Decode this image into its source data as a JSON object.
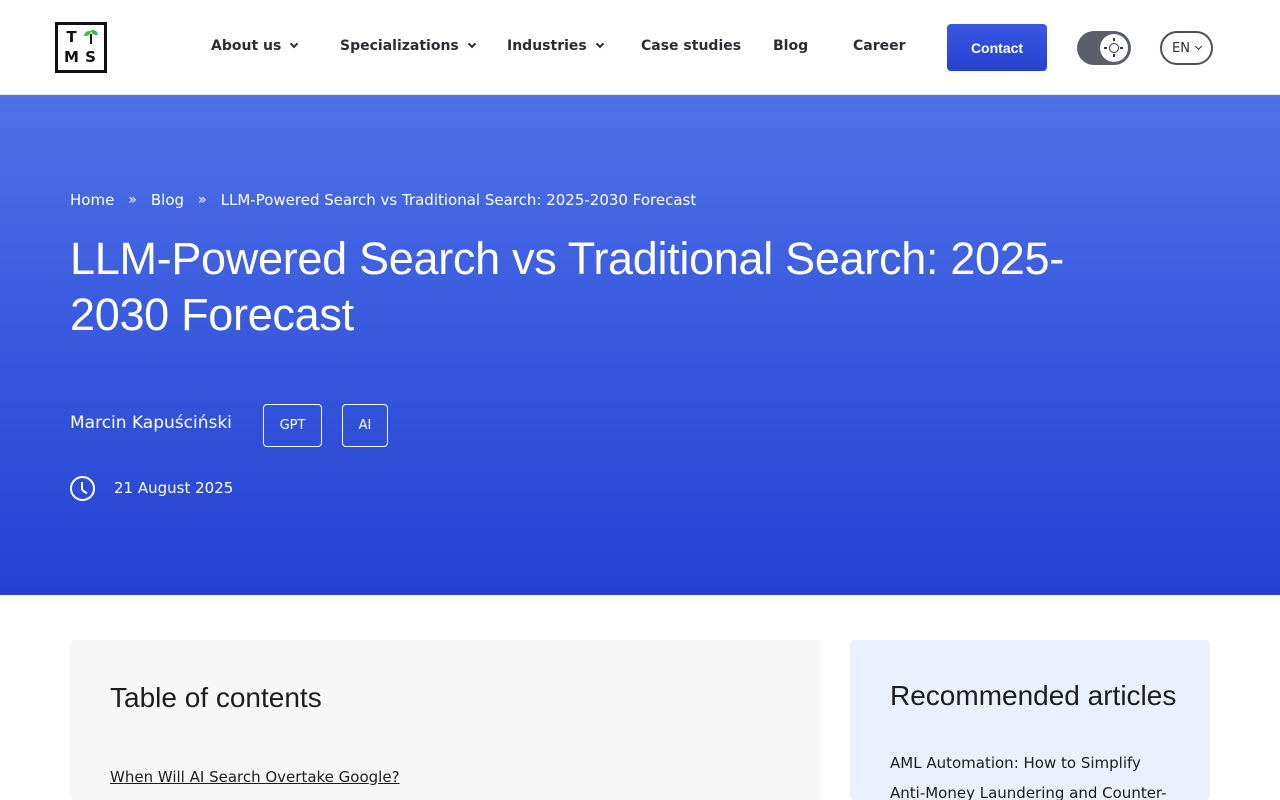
{
  "header": {
    "logo": {
      "letters": [
        "T",
        "M",
        "S"
      ]
    },
    "nav": [
      {
        "label": "About us",
        "has_dropdown": true
      },
      {
        "label": "Specializations",
        "has_dropdown": true
      },
      {
        "label": "Industries",
        "has_dropdown": true
      },
      {
        "label": "Case studies",
        "has_dropdown": false
      },
      {
        "label": "Blog",
        "has_dropdown": false
      },
      {
        "label": "Career",
        "has_dropdown": false
      }
    ],
    "contact_label": "Contact",
    "theme_toggle_icon": "sun-icon",
    "language": "EN",
    "accent_color": "#2f4ad8"
  },
  "hero": {
    "breadcrumb": {
      "home": "Home",
      "separator": "»",
      "blog": "Blog",
      "current": "LLM-Powered Search vs Traditional Search: 2025-2030 Forecast"
    },
    "title": "LLM-Powered Search vs Traditional Search: 2025-2030 Forecast",
    "author": "Marcin Kapuściński",
    "tags": [
      "GPT",
      "AI"
    ],
    "date": "21 August 2025"
  },
  "toc": {
    "heading": "Table of contents",
    "items": [
      "When Will AI Search Overtake Google?"
    ]
  },
  "recommended": {
    "heading": "Recommended articles",
    "items": [
      "AML Automation: How to Simplify Anti-Money Laundering and Counter-"
    ]
  }
}
